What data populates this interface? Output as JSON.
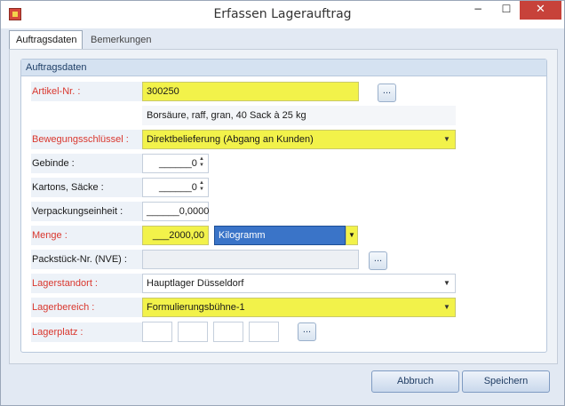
{
  "window": {
    "title": "Erfassen Lagerauftrag",
    "minimize": "−",
    "maximize": "☐",
    "close": "✕"
  },
  "tabs": [
    {
      "label": "Auftragsdaten",
      "active": true
    },
    {
      "label": "Bemerkungen",
      "active": false
    }
  ],
  "group": {
    "title": "Auftragsdaten"
  },
  "form": {
    "artikel_label": "Artikel-Nr. :",
    "artikel_value": "300250",
    "artikel_desc": "Borsäure, raff, gran, 40 Sack à 25 kg",
    "bewegung_label": "Bewegungsschlüssel :",
    "bewegung_value": "Direktbelieferung (Abgang an Kunden)",
    "gebinde_label": "Gebinde :",
    "gebinde_value": "______0",
    "kartons_label": "Kartons, Säcke :",
    "kartons_value": "______0",
    "verpackung_label": "Verpackungseinheit :",
    "verpackung_value": "______0,0000",
    "menge_label": "Menge :",
    "menge_value": "___2000,00",
    "menge_unit": "Kilogramm",
    "packstueck_label": "Packstück-Nr. (NVE) :",
    "packstueck_value": "",
    "lagerstandort_label": "Lagerstandort :",
    "lagerstandort_value": "Hauptlager Düsseldorf",
    "lagerbereich_label": "Lagerbereich :",
    "lagerbereich_value": "Formulierungsbühne-1",
    "lagerplatz_label": "Lagerplatz :",
    "ellipsis": "..."
  },
  "buttons": {
    "cancel": "Abbruch",
    "save": "Speichern"
  },
  "icons": {
    "dropdown": "▼",
    "spin_up": "▲",
    "spin_down": "▼"
  },
  "colors": {
    "required_label": "#d9372e",
    "required_field": "#f2f24a",
    "selection": "#3a74c8",
    "close": "#c7423a"
  }
}
